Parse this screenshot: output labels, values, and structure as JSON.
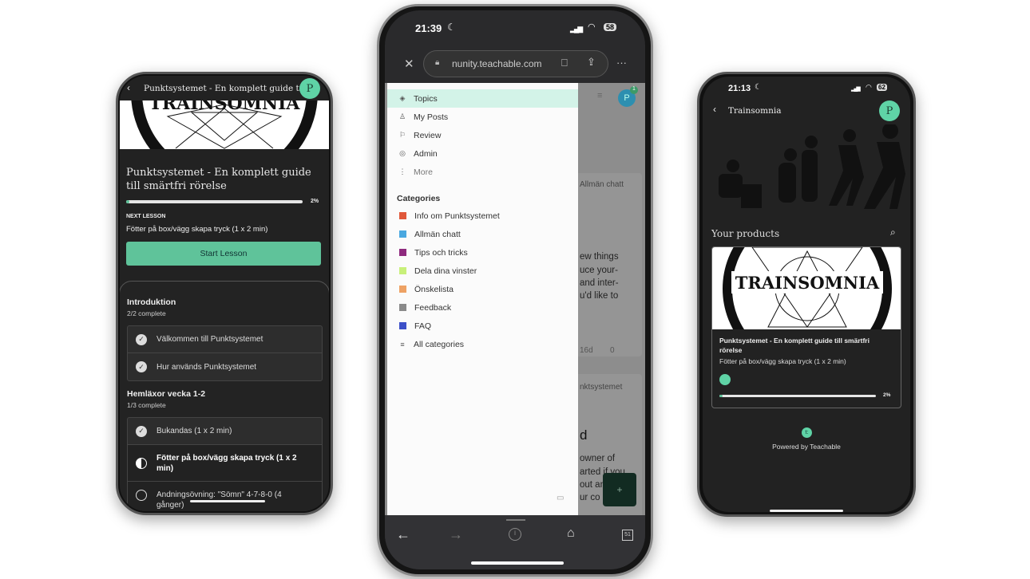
{
  "left_phone": {
    "header_title": "Punktsystemet - En komplett guide till...",
    "avatar_initial": "P",
    "logo_text": "TRAINSOMNIA",
    "course_title": "Punktsystemet - En komplett guide till smärtfri rörelse",
    "progress_percent": 2,
    "progress_label": "2%",
    "next_lesson_label": "NEXT LESSON",
    "next_lesson": "Fötter på box/vägg skapa tryck (1 x 2 min)",
    "start_button": "Start Lesson",
    "sections": [
      {
        "title": "Introduktion",
        "status": "2/2 complete",
        "lessons": [
          {
            "name": "Välkommen till Punktsystemet",
            "state": "complete"
          },
          {
            "name": "Hur används Punktsystemet",
            "state": "complete"
          }
        ]
      },
      {
        "title": "Hemläxor vecka 1-2",
        "status": "1/3 complete",
        "lessons": [
          {
            "name": "Bukandas (1 x 2 min)",
            "state": "complete"
          },
          {
            "name": "Fötter på box/vägg skapa tryck (1 x 2 min)",
            "state": "in-progress"
          },
          {
            "name": "Andningsövning: \"Sömn\" 4-7-8-0 (4 gånger)",
            "state": "not-started"
          }
        ]
      }
    ]
  },
  "middle_phone": {
    "time": "21:39",
    "battery": "58",
    "url": "nunity.teachable.com",
    "nav": [
      {
        "label": "Topics",
        "icon": "layers-icon",
        "active": true
      },
      {
        "label": "My Posts",
        "icon": "user-icon"
      },
      {
        "label": "Review",
        "icon": "flag-icon"
      },
      {
        "label": "Admin",
        "icon": "admin-icon"
      },
      {
        "label": "More",
        "icon": "more-vertical-icon"
      }
    ],
    "categories_title": "Categories",
    "categories": [
      {
        "label": "Info om Punktsystemet",
        "color": "#e0583a"
      },
      {
        "label": "Allmän chatt",
        "color": "#4aa8e0"
      },
      {
        "label": "Tips och tricks",
        "color": "#8e2a7e"
      },
      {
        "label": "Dela dina vinster",
        "color": "#c8f07a"
      },
      {
        "label": "Önskelista",
        "color": "#eea264"
      },
      {
        "label": "Feedback",
        "color": "#8a8a8a"
      },
      {
        "label": "FAQ",
        "color": "#3c50c8"
      }
    ],
    "all_categories": "All categories",
    "avatar_initial": "P",
    "notification_count": "1",
    "bg_texts": [
      "Allmän chatt",
      "ew things",
      "uce your-",
      "and inter-",
      "u'd like to",
      "16d",
      "0",
      "nktsystemet",
      "d",
      "owner of",
      "arted if you",
      "out an",
      "ur co"
    ],
    "fab": "+",
    "tabs_count": "51"
  },
  "right_phone": {
    "time": "21:13",
    "battery": "62",
    "header_title": "Trainsomnia",
    "avatar_initial": "P",
    "section_title": "Your products",
    "logo_text": "TRAINSOMNIA",
    "product_title": "Punktsystemet - En komplett guide till smärtfri rörelse",
    "product_next": "Fötter på box/vägg skapa tryck (1 x 2 min)",
    "progress_percent": 2,
    "progress_label": "2%",
    "powered_by": "Powered by Teachable"
  },
  "colors": {
    "accent": "#5fc39a",
    "dark_bg": "#222222",
    "menu_active": "#d3f3e8"
  }
}
